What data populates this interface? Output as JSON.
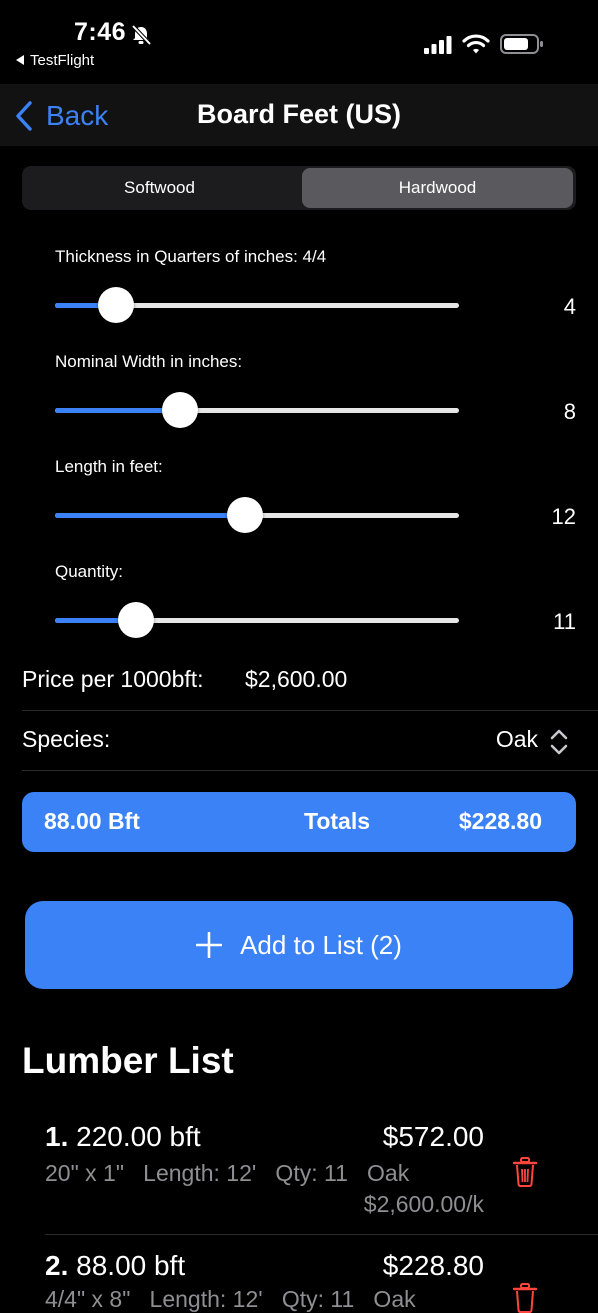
{
  "status": {
    "time": "7:46",
    "back_app": "TestFlight"
  },
  "nav": {
    "back_label": "Back",
    "title": "Board Feet (US)"
  },
  "segments": {
    "softwood": "Softwood",
    "hardwood": "Hardwood",
    "selected": "Hardwood"
  },
  "sliders": [
    {
      "label": "Thickness in Quarters of inches: 4/4",
      "value": "4",
      "fill_fraction": 0.15
    },
    {
      "label": "Nominal Width in inches:",
      "value": "8",
      "fill_fraction": 0.31
    },
    {
      "label": "Length in feet:",
      "value": "12",
      "fill_fraction": 0.47
    },
    {
      "label": "Quantity:",
      "value": "11",
      "fill_fraction": 0.2
    }
  ],
  "price": {
    "label": "Price per 1000bft:",
    "value": "$2,600.00"
  },
  "species": {
    "label": "Species:",
    "value": "Oak"
  },
  "totals": {
    "bft": "88.00 Bft",
    "label": "Totals",
    "price": "$228.80"
  },
  "add_button": {
    "label": "Add to List (2)"
  },
  "list": {
    "title": "Lumber List",
    "items": [
      {
        "num": "1.",
        "bft": "220.00 bft",
        "price": "$572.00",
        "detail": "20\" x 1\"   Length: 12'   Qty: 11   Oak",
        "rate": "$2,600.00/k"
      },
      {
        "num": "2.",
        "bft": "88.00 bft",
        "price": "$228.80",
        "detail": "4/4\" x 8\"   Length: 12'   Qty: 11   Oak",
        "rate": ""
      }
    ]
  },
  "colors": {
    "accent": "#3b82f6",
    "destructive": "#ff453a",
    "secondary_text": "#8e8e93"
  }
}
